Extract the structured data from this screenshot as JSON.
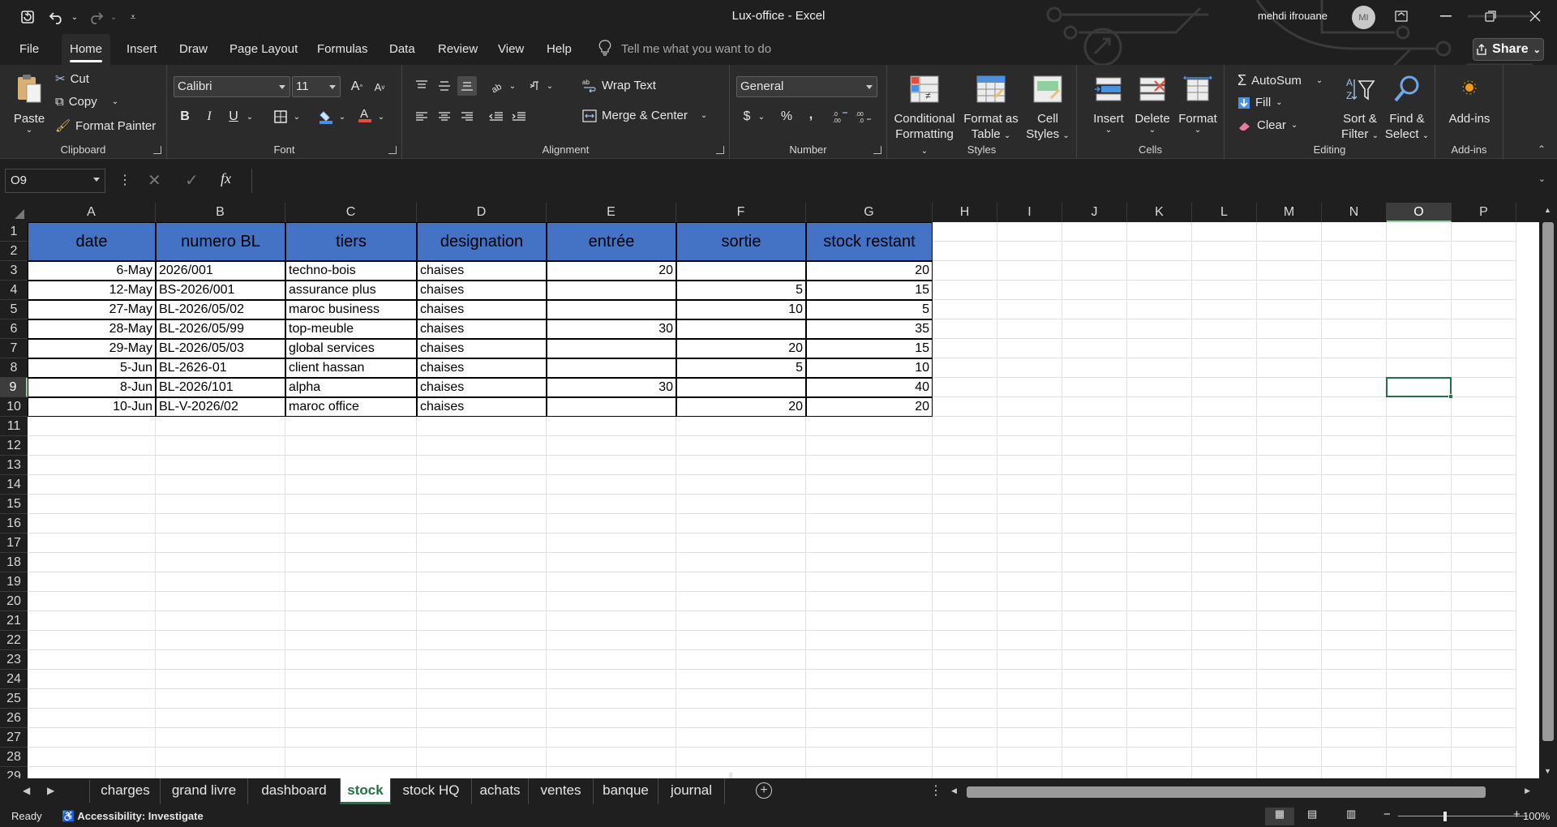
{
  "window": {
    "title": "Lux-office  -  Excel",
    "user_name": "mehdi ifrouane",
    "user_initials": "MI"
  },
  "quick_access": {
    "autosave_icon": "autosave-icon",
    "undo_icon": "undo-icon",
    "redo_icon": "redo-icon",
    "customize_icon": "customize-icon"
  },
  "menu": {
    "tabs": [
      "File",
      "Home",
      "Insert",
      "Draw",
      "Page Layout",
      "Formulas",
      "Data",
      "Review",
      "View",
      "Help"
    ],
    "active": "Home",
    "tell_me": "Tell me what you want to do",
    "share": "Share"
  },
  "ribbon": {
    "clipboard": {
      "label": "Clipboard",
      "paste": "Paste",
      "cut": "Cut",
      "copy": "Copy",
      "format_painter": "Format Painter"
    },
    "font": {
      "label": "Font",
      "family": "Calibri",
      "size": "11",
      "bold": "B",
      "italic": "I",
      "underline": "U",
      "grow": "A",
      "shrink": "A"
    },
    "alignment": {
      "label": "Alignment",
      "wrap_text": "Wrap Text",
      "merge_center": "Merge & Center"
    },
    "number": {
      "label": "Number",
      "format": "General",
      "currency": "$",
      "percent": "%",
      "comma": ","
    },
    "styles": {
      "label": "Styles",
      "conditional_formatting": [
        "Conditional",
        "Formatting"
      ],
      "format_as_table": [
        "Format as",
        "Table"
      ],
      "cell_styles": [
        "Cell",
        "Styles"
      ]
    },
    "cells": {
      "label": "Cells",
      "insert": "Insert",
      "delete": "Delete",
      "format": "Format"
    },
    "editing": {
      "label": "Editing",
      "autosum": "AutoSum",
      "fill": "Fill",
      "clear": "Clear",
      "sort_filter": [
        "Sort &",
        "Filter"
      ],
      "find_select": [
        "Find &",
        "Select"
      ]
    },
    "addins": {
      "label": "Add-ins",
      "button": "Add-ins"
    }
  },
  "formula_bar": {
    "name_box": "O9",
    "fx": "fx",
    "value": ""
  },
  "sheet": {
    "columns": [
      "A",
      "B",
      "C",
      "D",
      "E",
      "F",
      "G",
      "H",
      "I",
      "J",
      "K",
      "L",
      "M",
      "N",
      "O",
      "P"
    ],
    "selected_column": "O",
    "selected_row": 9,
    "row_count": 29,
    "headers": [
      "date",
      "numero BL",
      "tiers",
      "designation",
      "entrée",
      "sortie",
      "stock restant"
    ],
    "rows": [
      [
        "6-May",
        "2026/001",
        "techno-bois",
        "chaises",
        "20",
        "",
        "20"
      ],
      [
        "12-May",
        "BS-2026/001",
        "assurance plus",
        "chaises",
        "",
        "5",
        "15"
      ],
      [
        "27-May",
        "BL-2026/05/02",
        "maroc business",
        "chaises",
        "",
        "10",
        "5"
      ],
      [
        "28-May",
        "BL-2026/05/99",
        "top-meuble",
        "chaises",
        "30",
        "",
        "35"
      ],
      [
        "29-May",
        "BL-2026/05/03",
        "global services",
        "chaises",
        "",
        "20",
        "15"
      ],
      [
        "5-Jun",
        "BL-2626-01",
        "client hassan",
        "chaises",
        "",
        "5",
        "10"
      ],
      [
        "8-Jun",
        "BL-2026/101",
        "alpha",
        "chaises",
        "30",
        "",
        "40"
      ],
      [
        "10-Jun",
        "BL-V-2026/02",
        "maroc office",
        "chaises",
        "",
        "20",
        "20"
      ]
    ],
    "header_color": "#4472c4"
  },
  "sheet_tabs": {
    "tabs": [
      "charges",
      "grand livre",
      "dashboard",
      "stock",
      "stock HQ",
      "achats",
      "ventes",
      "banque",
      "journal"
    ],
    "active": "stock"
  },
  "status": {
    "ready": "Ready",
    "accessibility": "Accessibility: Investigate",
    "zoom": "100%"
  },
  "watermark": "خمسات",
  "accent_color": "#217346"
}
